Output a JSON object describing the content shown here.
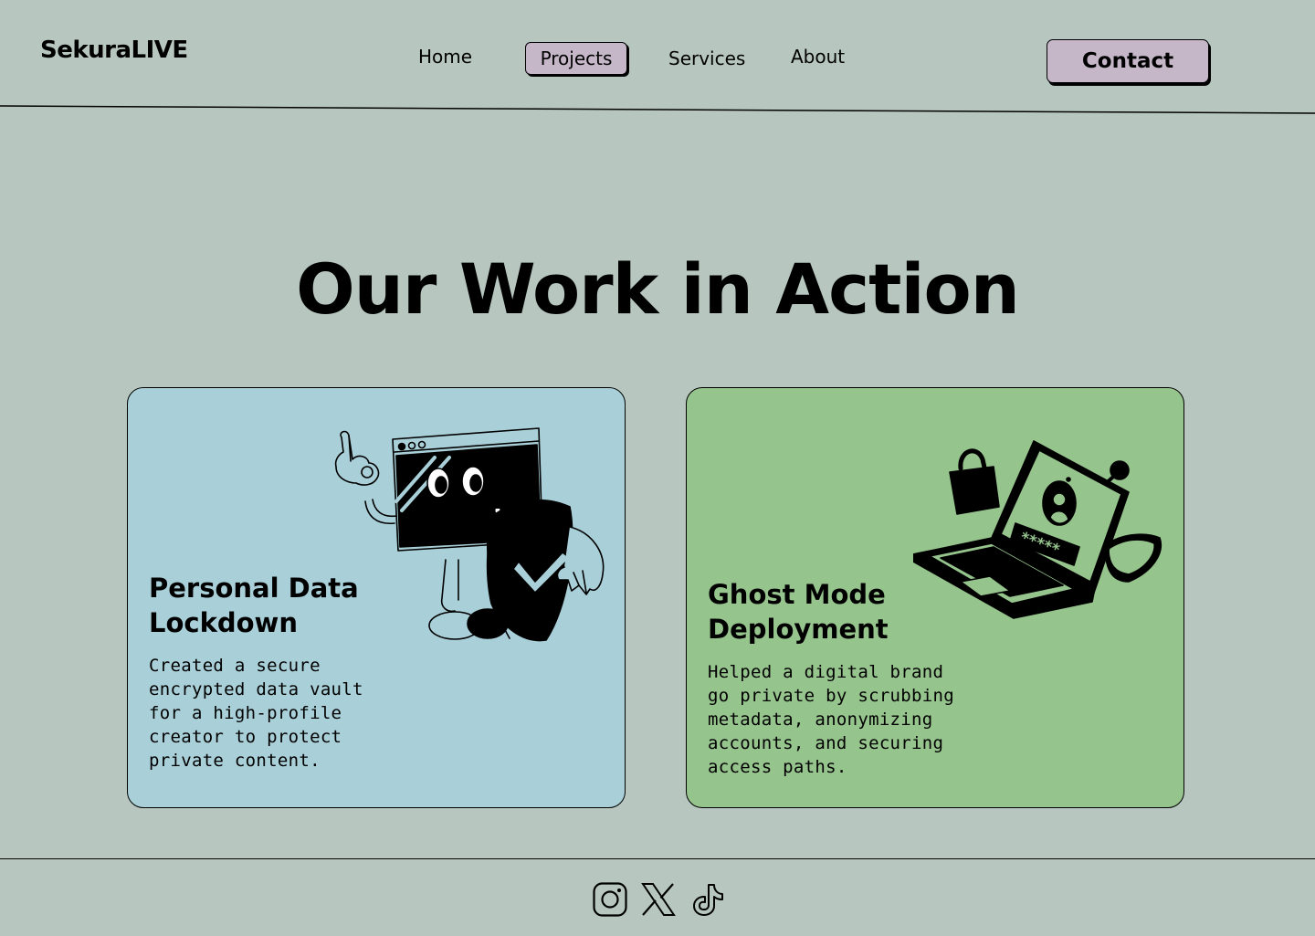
{
  "header": {
    "logo": "SekuraLIVE",
    "nav": {
      "home": "Home",
      "projects": "Projects",
      "services": "Services",
      "about": "About"
    },
    "contact_label": "Contact"
  },
  "main": {
    "title": "Our Work in Action",
    "cards": [
      {
        "title": "Personal Data Lockdown",
        "description": "Created a secure encrypted data vault for a high-profile creator to protect private content.",
        "illustration": "computer-shield-mascot-icon",
        "background": "#a9d0d9"
      },
      {
        "title": "Ghost Mode Deployment",
        "description": "Helped a digital brand go private by scrubbing metadata, anonymizing accounts, and securing access paths.",
        "illustration": "laptop-lock-key-icon",
        "background": "#96c48d"
      }
    ]
  },
  "footer": {
    "social": [
      "instagram-icon",
      "x-icon",
      "tiktok-icon"
    ]
  },
  "colors": {
    "page_background": "#b7c7c0",
    "button_accent": "#c5b7c8"
  }
}
